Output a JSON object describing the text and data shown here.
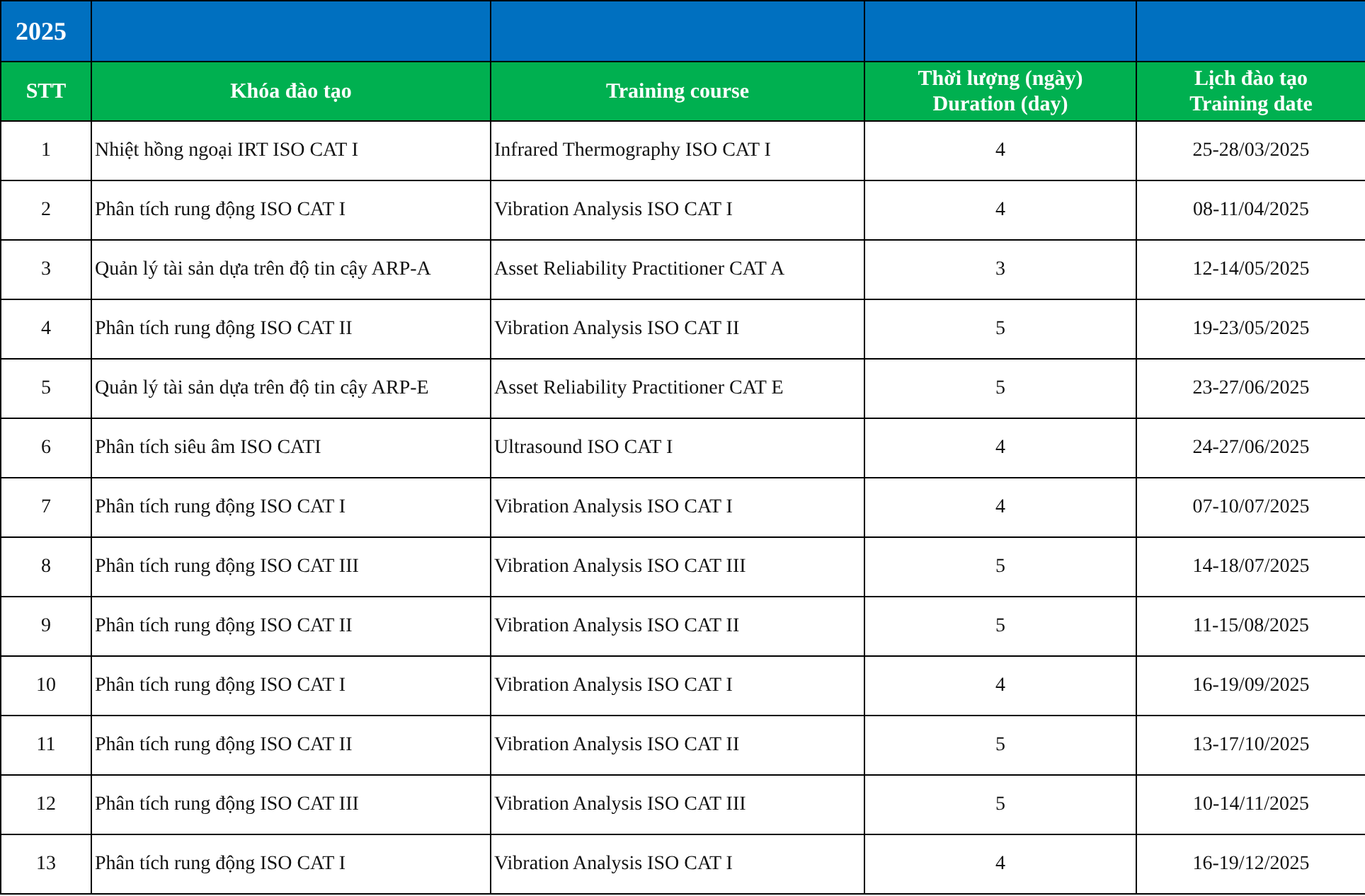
{
  "title": "2025",
  "columns": [
    "STT",
    "Khóa đào tạo",
    "Training course",
    "Thời lượng (ngày)\nDuration (day)",
    "Lịch đào tạo\nTraining date"
  ],
  "rows": [
    [
      "1",
      "Nhiệt hồng ngoại IRT ISO CAT I",
      "Infrared Thermography ISO CAT I",
      "4",
      "25-28/03/2025"
    ],
    [
      "2",
      "Phân tích rung động ISO CAT I",
      "Vibration Analysis ISO CAT I",
      "4",
      "08-11/04/2025"
    ],
    [
      "3",
      "Quản lý tài sản dựa trên độ tin cậy ARP-A",
      "Asset Reliability Practitioner  CAT A",
      "3",
      "12-14/05/2025"
    ],
    [
      "4",
      "Phân tích rung động ISO CAT II",
      "Vibration Analysis ISO CAT II",
      "5",
      "19-23/05/2025"
    ],
    [
      "5",
      "Quản lý tài sản dựa trên độ tin cậy ARP-E",
      "Asset Reliability Practitioner CAT E",
      "5",
      "23-27/06/2025"
    ],
    [
      "6",
      "Phân tích siêu âm ISO CATI",
      "Ultrasound ISO CAT I",
      "4",
      "24-27/06/2025"
    ],
    [
      "7",
      "Phân tích rung động ISO CAT I",
      "Vibration Analysis ISO CAT I",
      "4",
      "07-10/07/2025"
    ],
    [
      "8",
      "Phân tích rung động ISO CAT III",
      "Vibration Analysis ISO CAT III",
      "5",
      "14-18/07/2025"
    ],
    [
      "9",
      "Phân tích rung động ISO CAT II",
      "Vibration Analysis ISO CAT II",
      "5",
      "11-15/08/2025"
    ],
    [
      "10",
      "Phân tích rung động ISO CAT I",
      "Vibration Analysis ISO CAT I",
      "4",
      "16-19/09/2025"
    ],
    [
      "11",
      "Phân tích rung động ISO CAT II",
      "Vibration Analysis ISO CAT II",
      "5",
      "13-17/10/2025"
    ],
    [
      "12",
      "Phân tích rung động ISO CAT III",
      "Vibration Analysis ISO CAT III",
      "5",
      "10-14/11/2025"
    ],
    [
      "13",
      "Phân tích rung động ISO CAT I",
      "Vibration Analysis ISO CAT I",
      "4",
      "16-19/12/2025"
    ]
  ]
}
